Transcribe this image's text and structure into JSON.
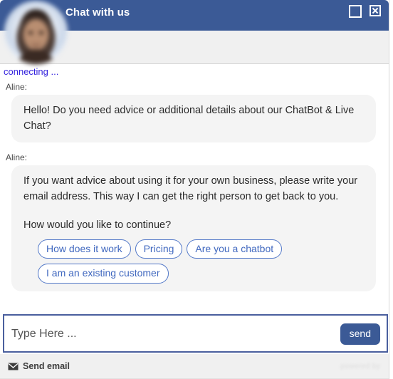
{
  "header": {
    "title": "Chat with us",
    "expand_icon": "expand-icon",
    "close_icon": "close-icon",
    "background_color": "#3b5a96"
  },
  "avatar": {
    "alt": "agent-avatar",
    "name": "agent-photo"
  },
  "status": {
    "text": "connecting ...",
    "color": "#3322dd"
  },
  "transcript": {
    "messages": [
      {
        "sender": "Aline:",
        "paragraphs": [
          "Hello! Do you need advice or additional details about our ChatBot & Live Chat?"
        ]
      },
      {
        "sender": "Aline:",
        "paragraphs": [
          "If you want advice about using it for your own business, please write your email address. This way I can get the right person to get back to you.",
          "How would you like to continue?"
        ]
      }
    ],
    "quick_replies": [
      "How does it work",
      "Pricing",
      "Are you a chatbot",
      "I am an existing customer"
    ],
    "quick_reply_color": "#4068bf"
  },
  "composer": {
    "placeholder": "Type Here ...",
    "value": "",
    "send_label": "send",
    "send_color": "#3b5a96"
  },
  "footer": {
    "send_email_label": "Send email",
    "envelope_icon": "envelope-icon",
    "watermark": "powered by"
  }
}
